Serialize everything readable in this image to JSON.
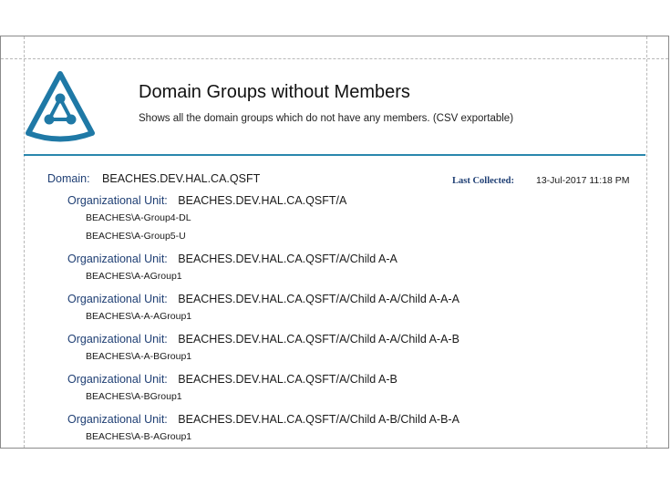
{
  "report": {
    "title": "Domain Groups without Members",
    "subtitle": "Shows all the domain groups which do not have any members. (CSV exportable)"
  },
  "colors": {
    "accent": "#2a87ad",
    "label": "#1f3f74",
    "logo": "#1f79a6"
  },
  "logo_icon": "triangle-logo-icon",
  "domain": {
    "label": "Domain:",
    "value": "BEACHES.DEV.HAL.CA.QSFT",
    "last_collected_label": "Last Collected:",
    "last_collected_value": "13-Jul-2017 11:18 PM"
  },
  "ou_label": "Organizational Unit:",
  "ous": [
    {
      "path": "BEACHES.DEV.HAL.CA.QSFT/A",
      "groups": [
        "BEACHES\\A-Group4-DL",
        "BEACHES\\A-Group5-U"
      ]
    },
    {
      "path": "BEACHES.DEV.HAL.CA.QSFT/A/Child A-A",
      "groups": [
        "BEACHES\\A-AGroup1"
      ]
    },
    {
      "path": "BEACHES.DEV.HAL.CA.QSFT/A/Child A-A/Child A-A-A",
      "groups": [
        "BEACHES\\A-A-AGroup1"
      ]
    },
    {
      "path": "BEACHES.DEV.HAL.CA.QSFT/A/Child A-A/Child A-A-B",
      "groups": [
        "BEACHES\\A-A-BGroup1"
      ]
    },
    {
      "path": "BEACHES.DEV.HAL.CA.QSFT/A/Child A-B",
      "groups": [
        "BEACHES\\A-BGroup1"
      ]
    },
    {
      "path": "BEACHES.DEV.HAL.CA.QSFT/A/Child A-B/Child A-B-A",
      "groups": [
        "BEACHES\\A-B-AGroup1"
      ]
    }
  ]
}
